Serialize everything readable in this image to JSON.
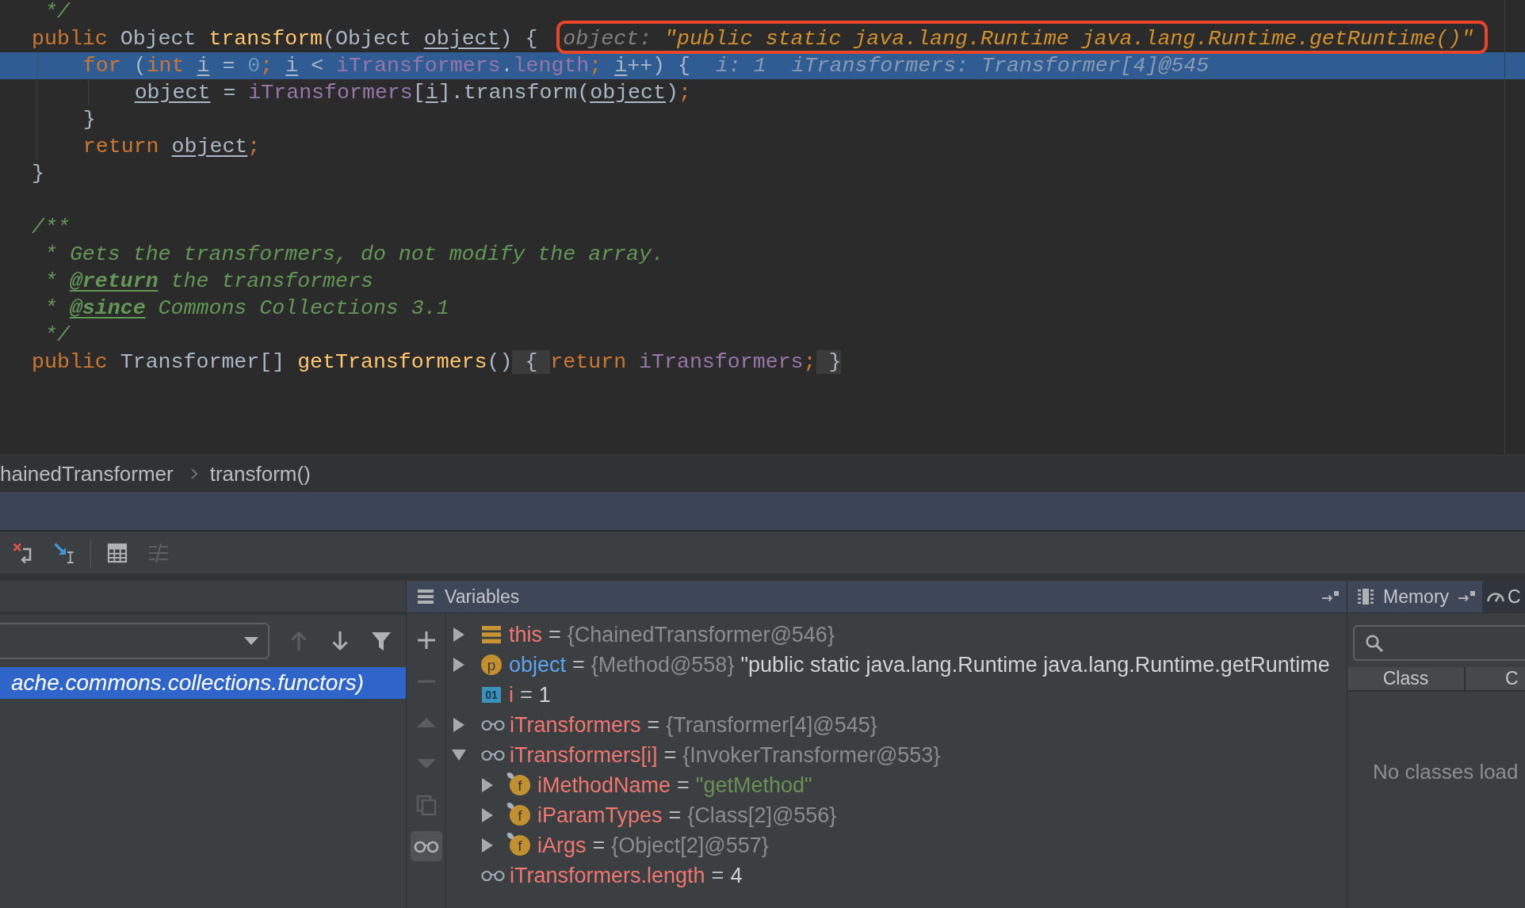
{
  "editor": {
    "blocks": [
      {
        "lines": [
          {
            "tokens": [
              {
                "text": " */",
                "kind": "comment"
              }
            ],
            "current": false
          },
          {
            "tokens": [
              {
                "text": "public",
                "kind": "keyword"
              },
              {
                "text": " Object ",
                "kind": "plain"
              },
              {
                "text": "transform",
                "kind": "method"
              },
              {
                "text": "(Object ",
                "kind": "plain"
              },
              {
                "text": "object",
                "kind": "local"
              },
              {
                "text": ") {",
                "kind": "plain"
              }
            ],
            "current": false,
            "inline_values": [
              {
                "label": "object:",
                "value": "\"public static java.lang.Runtime java.lang.Runtime.getRuntime()\"",
                "kind": "string",
                "framed": true
              }
            ],
            "children": [
              {
                "tokens": [
                  {
                    "text": "for",
                    "kind": "keyword"
                  },
                  {
                    "text": " (",
                    "kind": "plain"
                  },
                  {
                    "text": "int ",
                    "kind": "keyword"
                  },
                  {
                    "text": "i",
                    "kind": "local"
                  },
                  {
                    "text": " = ",
                    "kind": "plain"
                  },
                  {
                    "text": "0",
                    "kind": "number"
                  },
                  {
                    "text": "; ",
                    "kind": "keyword"
                  },
                  {
                    "text": "i",
                    "kind": "local"
                  },
                  {
                    "text": " < ",
                    "kind": "plain"
                  },
                  {
                    "text": "iTransformers",
                    "kind": "field"
                  },
                  {
                    "text": ".",
                    "kind": "plain"
                  },
                  {
                    "text": "length",
                    "kind": "field"
                  },
                  {
                    "text": "; ",
                    "kind": "keyword"
                  },
                  {
                    "text": "i",
                    "kind": "local"
                  },
                  {
                    "text": "++) {",
                    "kind": "plain"
                  }
                ],
                "current": true,
                "inline_values": [
                  {
                    "label": "i:",
                    "value": "1",
                    "kind": "other",
                    "framed": false
                  },
                  {
                    "label": "iTransformers:",
                    "value": "Transformer[4]@545",
                    "kind": "other",
                    "framed": false
                  }
                ],
                "children": [
                  {
                    "tokens": [
                      {
                        "text": "object",
                        "kind": "local"
                      },
                      {
                        "text": " = ",
                        "kind": "plain"
                      },
                      {
                        "text": "iTransformers",
                        "kind": "field"
                      },
                      {
                        "text": "[",
                        "kind": "plain"
                      },
                      {
                        "text": "i",
                        "kind": "local"
                      },
                      {
                        "text": "].transform(",
                        "kind": "plain"
                      },
                      {
                        "text": "object",
                        "kind": "local"
                      },
                      {
                        "text": ")",
                        "kind": "plain"
                      },
                      {
                        "text": ";",
                        "kind": "keyword"
                      }
                    ],
                    "current": false
                  }
                ]
              },
              {
                "tokens": [
                  {
                    "text": "}",
                    "kind": "plain"
                  }
                ],
                "current": false
              },
              {
                "tokens": [
                  {
                    "text": "return ",
                    "kind": "keyword"
                  },
                  {
                    "text": "object",
                    "kind": "local"
                  },
                  {
                    "text": ";",
                    "kind": "keyword"
                  }
                ],
                "current": false
              }
            ]
          },
          {
            "tokens": [
              {
                "text": "}",
                "kind": "plain"
              }
            ],
            "current": false
          }
        ]
      },
      {
        "lines": [
          {
            "tokens": [
              {
                "text": "/**",
                "kind": "comment"
              }
            ],
            "current": false
          },
          {
            "tokens": [
              {
                "text": " * Gets the transformers, do not modify the array.",
                "kind": "comment"
              }
            ],
            "current": false
          },
          {
            "tokens": [
              {
                "text": " * ",
                "kind": "comment"
              },
              {
                "text": "@return",
                "kind": "doctag"
              },
              {
                "text": " the transformers",
                "kind": "comment"
              }
            ],
            "current": false
          },
          {
            "tokens": [
              {
                "text": " * ",
                "kind": "comment"
              },
              {
                "text": "@since",
                "kind": "doctag"
              },
              {
                "text": " Commons Collections 3.1",
                "kind": "comment"
              }
            ],
            "current": false
          },
          {
            "tokens": [
              {
                "text": " */",
                "kind": "comment"
              }
            ],
            "current": false
          },
          {
            "tokens": [
              {
                "text": "public",
                "kind": "keyword"
              },
              {
                "text": " Transformer[] ",
                "kind": "plain"
              },
              {
                "text": "getTransformers",
                "kind": "method"
              },
              {
                "text": "()",
                "kind": "plain"
              },
              {
                "text": " { ",
                "kind": "fold"
              },
              {
                "text": "return ",
                "kind": "keyword"
              },
              {
                "text": "iTransformers",
                "kind": "field"
              },
              {
                "text": ";",
                "kind": "keyword"
              },
              {
                "text": " }",
                "kind": "fold"
              }
            ],
            "current": false
          }
        ]
      }
    ]
  },
  "breadcrumbs": [
    "hainedTransformer",
    "transform()"
  ],
  "debug_toolbar": {
    "groups": [
      {
        "buttons": [
          {
            "kind": "drop-frame",
            "disabled": false
          },
          {
            "kind": "run-to-cursor",
            "disabled": false
          }
        ]
      },
      {
        "buttons": [
          {
            "kind": "evaluate",
            "disabled": false
          },
          {
            "kind": "trace",
            "disabled": true
          }
        ]
      }
    ]
  },
  "frames": {
    "toolbar": [
      {
        "kind": "up",
        "disabled": true
      },
      {
        "kind": "down",
        "disabled": false
      },
      {
        "kind": "filter",
        "disabled": false
      }
    ],
    "items": [
      {
        "label": "ache.commons.collections.functors)",
        "selected": true
      }
    ]
  },
  "variables": {
    "title": "Variables",
    "toolbar": [
      {
        "kind": "add",
        "disabled": false,
        "on": false
      },
      {
        "kind": "remove",
        "disabled": true,
        "on": false
      },
      {
        "kind": "up",
        "disabled": true,
        "on": false
      },
      {
        "kind": "down",
        "disabled": true,
        "on": false
      },
      {
        "kind": "copy",
        "disabled": true,
        "on": false
      },
      {
        "kind": "watches",
        "disabled": false,
        "on": true
      }
    ],
    "items": [
      {
        "kind": "this",
        "name": "this",
        "separator": "=",
        "value": {
          "text": "{ChainedTransformer@546}",
          "kind": "reference"
        },
        "expanded": false
      },
      {
        "kind": "parameter",
        "badge": "p",
        "name": "object",
        "separator": "=",
        "value": {
          "text": "{Method@558}",
          "kind": "reference"
        },
        "description": "\"public static java.lang.Runtime java.lang.Runtime.getRuntime",
        "expanded": false
      },
      {
        "kind": "local",
        "badge": "01",
        "name": "i",
        "separator": "=",
        "value": {
          "text": "1",
          "kind": "number"
        }
      },
      {
        "kind": "watch",
        "name": "iTransformers",
        "separator": "=",
        "value": {
          "text": "{Transformer[4]@545}",
          "kind": "reference"
        },
        "expanded": false
      },
      {
        "kind": "watch",
        "name": "iTransformers[i]",
        "separator": "=",
        "value": {
          "text": "{InvokerTransformer@553}",
          "kind": "reference"
        },
        "expanded": true,
        "children": [
          {
            "kind": "field",
            "badge": "f",
            "final": true,
            "name": "iMethodName",
            "separator": "=",
            "value": {
              "text": "\"getMethod\"",
              "kind": "string"
            },
            "expanded": false
          },
          {
            "kind": "field",
            "badge": "f",
            "final": true,
            "name": "iParamTypes",
            "separator": "=",
            "value": {
              "text": "{Class[2]@556}",
              "kind": "reference"
            },
            "expanded": false
          },
          {
            "kind": "field",
            "badge": "f",
            "final": true,
            "name": "iArgs",
            "separator": "=",
            "value": {
              "text": "{Object[2]@557}",
              "kind": "reference"
            },
            "expanded": false
          }
        ]
      },
      {
        "kind": "watch",
        "name": "iTransformers.length",
        "separator": "=",
        "value": {
          "text": "4",
          "kind": "number"
        }
      }
    ]
  },
  "memory": {
    "tabs": [
      {
        "kind": "memory",
        "label": "Memory",
        "selected": true
      },
      {
        "kind": "gauge",
        "label": "C",
        "selected": false
      }
    ],
    "table": {
      "columns": [
        "Class",
        "C"
      ],
      "empty_text": "No classes load"
    }
  }
}
